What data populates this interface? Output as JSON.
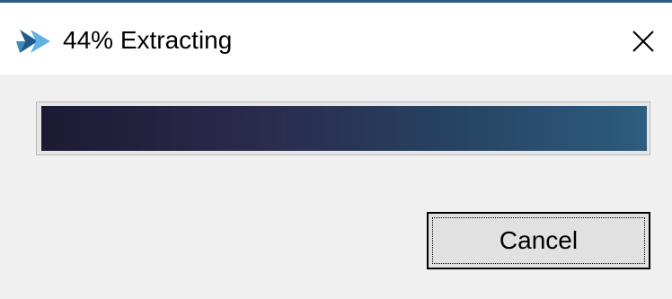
{
  "window": {
    "title": "44% Extracting"
  },
  "progress": {
    "percent": 44
  },
  "buttons": {
    "cancel_label": "Cancel"
  },
  "icons": {
    "app": "extractor-app-icon",
    "close": "close-icon"
  },
  "colors": {
    "titlebar_accent": "#2b5a86",
    "progress_start": "#1c1a33",
    "progress_end": "#2c5d80",
    "app_icon_dark": "#1f5b8a",
    "app_icon_light": "#5fb3e4"
  }
}
